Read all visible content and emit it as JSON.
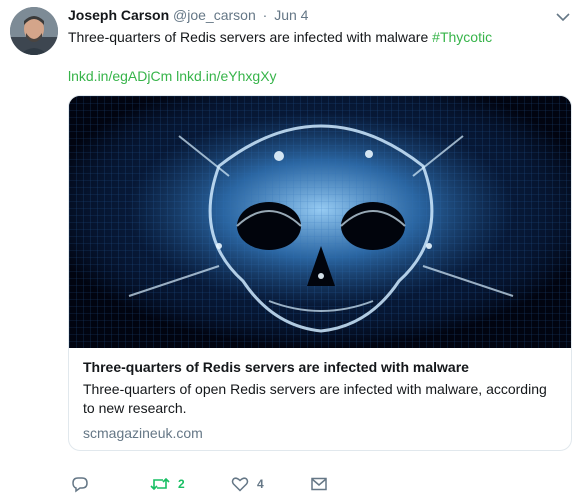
{
  "tweet": {
    "author_name": "Joseph Carson",
    "author_handle": "@joe_carson",
    "separator": "·",
    "timestamp": "Jun 4",
    "text": "Three-quarters of Redis servers are infected with malware ",
    "hashtag": "#Thycotic",
    "links": [
      "lnkd.in/egADjCm",
      "lnkd.in/eYhxgXy"
    ],
    "card": {
      "title": "Three-quarters of Redis servers are infected with malware",
      "description": "Three-quarters of open Redis servers are infected with malware, according to new research.",
      "domain": "scmagazineuk.com"
    },
    "actions": {
      "reply_icon": "reply-icon",
      "retweet_icon": "retweet-icon",
      "retweet_count": "2",
      "like_icon": "heart-icon",
      "like_count": "4",
      "message_icon": "envelope-icon"
    }
  },
  "colors": {
    "link": "#37b44a",
    "muted": "#657786",
    "retweet": "#17bf63",
    "text": "#14171a"
  }
}
